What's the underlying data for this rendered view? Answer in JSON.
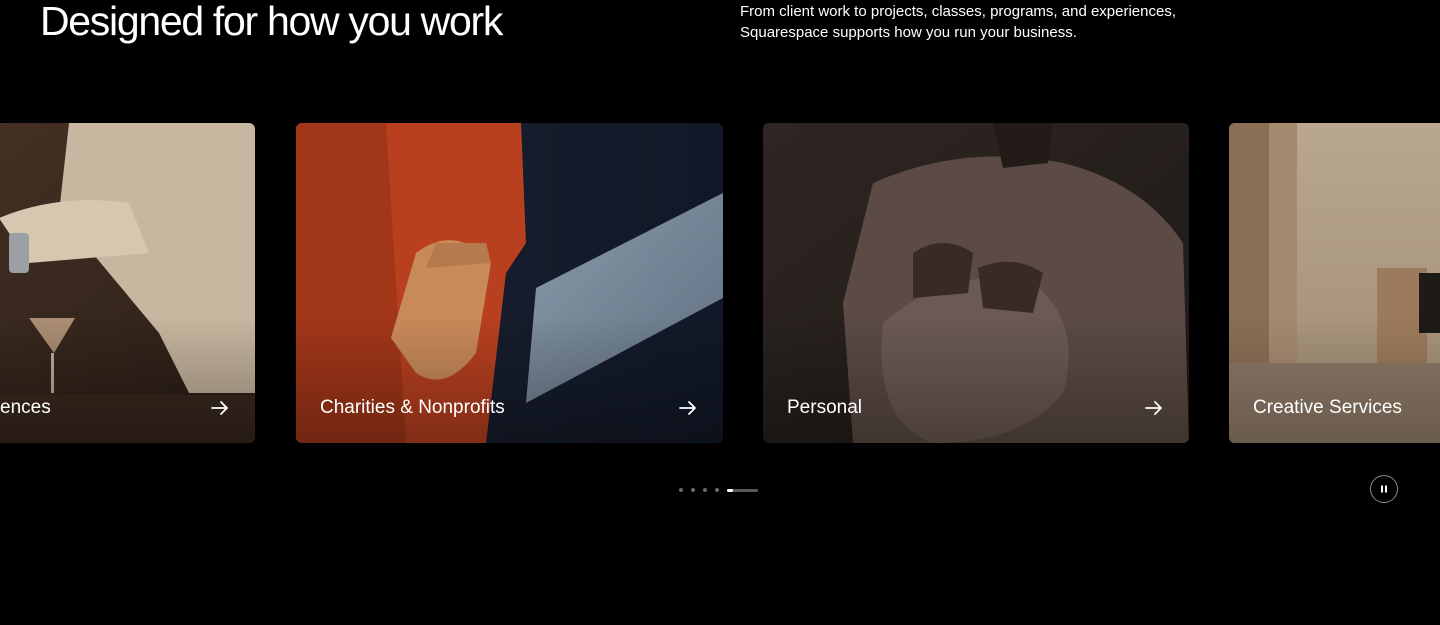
{
  "section": {
    "headline": "Designed for how you work",
    "subcopy": "From client work to projects, classes, programs, and experiences, Squarespace supports how you run your business."
  },
  "carousel": {
    "cards": [
      {
        "label": "Experiences",
        "visible_label": "ences",
        "image": "bartender-pouring-cocktail",
        "icon": "arrow-right-icon"
      },
      {
        "label": "Charities & Nonprofits",
        "image": "orange-corduroy-gloved-hand",
        "icon": "arrow-right-icon"
      },
      {
        "label": "Personal",
        "image": "person-holding-brown-bag",
        "icon": "arrow-right-icon"
      },
      {
        "label": "Creative Services",
        "image": "beige-room-with-pillar",
        "icon": "arrow-right-icon"
      }
    ],
    "pagination": {
      "total": 5,
      "active_index": 4,
      "active_progress": 0.2
    },
    "pause_control": {
      "icon": "pause-icon"
    }
  },
  "colors": {
    "background": "#000000",
    "text": "#ffffff",
    "dot_inactive": "#6a6a6a"
  }
}
